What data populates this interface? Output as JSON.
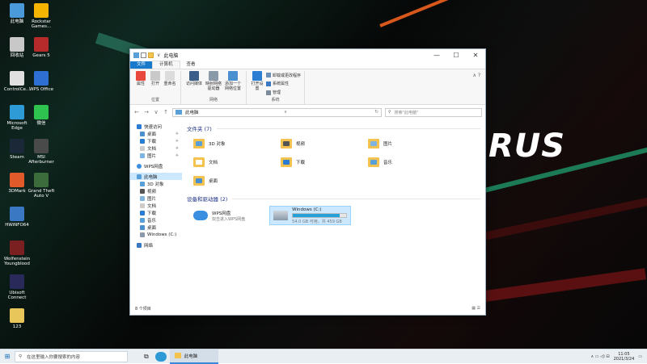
{
  "desktop": {
    "brand_text": "RUS",
    "icons": [
      {
        "label": "此电脑",
        "color": "#4a9ad9"
      },
      {
        "label": "Rockstar Games...",
        "color": "#f5b400"
      },
      {
        "label": "回收站",
        "color": "#c8c8c8"
      },
      {
        "label": "Gears 5",
        "color": "#b52b2b"
      },
      {
        "label": "ControlCe...",
        "color": "#e0e0e0"
      },
      {
        "label": "WPS Office",
        "color": "#2d6fd3"
      },
      {
        "label": "Microsoft Edge",
        "color": "#2e9bd6"
      },
      {
        "label": "微信",
        "color": "#2ec24f"
      },
      {
        "label": "Steam",
        "color": "#1b2838"
      },
      {
        "label": "MSI Afterburner",
        "color": "#4a4a4a"
      },
      {
        "label": "3DMark",
        "color": "#e05a2a"
      },
      {
        "label": "Grand Theft Auto V",
        "color": "#3c6b3c"
      },
      {
        "label": "HWiNFO64",
        "color": "#3a78c4"
      },
      {
        "label": "Wolfenstein Youngblood",
        "color": "#7a2020"
      },
      {
        "label": "Ubisoft Connect",
        "color": "#2a2a5a"
      },
      {
        "label": "123",
        "color": "#e8c65a"
      }
    ]
  },
  "window": {
    "title": "此电脑",
    "quick_access_glyph": "∨",
    "controls": {
      "minimize": "—",
      "maximize": "☐",
      "close": "✕"
    },
    "tabs": [
      "文件",
      "计算机",
      "查看"
    ],
    "ribbon": {
      "groups": [
        {
          "label": "位置",
          "buttons": [
            "属性",
            "打开",
            "重命名"
          ]
        },
        {
          "label": "网络",
          "buttons": [
            "访问媒体",
            "映射网络驱动器",
            "添加一个网络位置"
          ]
        },
        {
          "label": "系统",
          "buttons": [
            "打开设置"
          ],
          "small": [
            "卸载或更改程序",
            "系统属性",
            "管理"
          ]
        }
      ],
      "collapse": "∧ ?"
    },
    "address": {
      "back": "←",
      "forward": "→",
      "recent": "∨",
      "up": "↑",
      "path": "此电脑",
      "dropdown": "∨",
      "refresh": "↻",
      "search_placeholder": "搜索\"此电脑\""
    },
    "navpane": {
      "quick_access": "快速访问",
      "quick_items": [
        {
          "label": "桌面",
          "pin": "✈"
        },
        {
          "label": "下载",
          "pin": "✈"
        },
        {
          "label": "文档",
          "pin": "✈"
        },
        {
          "label": "图片",
          "pin": "✈"
        }
      ],
      "wps": "WPS网盘",
      "this_pc": "此电脑",
      "pc_items": [
        "3D 对象",
        "视频",
        "图片",
        "文档",
        "下载",
        "音乐",
        "桌面",
        "Windows (C:)"
      ],
      "network": "网络"
    },
    "folders_header": "文件夹 (7)",
    "folders": [
      {
        "label": "3D 对象",
        "color": "#5aa0d8"
      },
      {
        "label": "视频",
        "color": "#555"
      },
      {
        "label": "图片",
        "color": "#7fb3e0"
      },
      {
        "label": "文档",
        "color": "#fff"
      },
      {
        "label": "下载",
        "color": "#2b7cd3"
      },
      {
        "label": "音乐",
        "color": "#5aa0d8"
      },
      {
        "label": "桌面",
        "color": "#4a8fd0"
      }
    ],
    "drives_header": "设备和驱动器 (2)",
    "drives": [
      {
        "name": "WPS网盘",
        "sub": "双击进入WPS网盘"
      },
      {
        "name": "Windows (C:)",
        "sub": "54.0 GB 可用，共 459 GB",
        "used_fraction": 0.88
      }
    ],
    "status": "8 个项目",
    "view_icons": "▦ ☰"
  },
  "taskbar": {
    "start_glyph": "⊞",
    "search_icon": "⚲",
    "search_text": "在这里输入你要搜索的内容",
    "task_view": "⧉",
    "app_label": "此电脑",
    "tray_glyphs": "∧ ▭ ◁) ⊟",
    "time": "11:05",
    "date": "2021/3/24",
    "notify": "▭"
  }
}
